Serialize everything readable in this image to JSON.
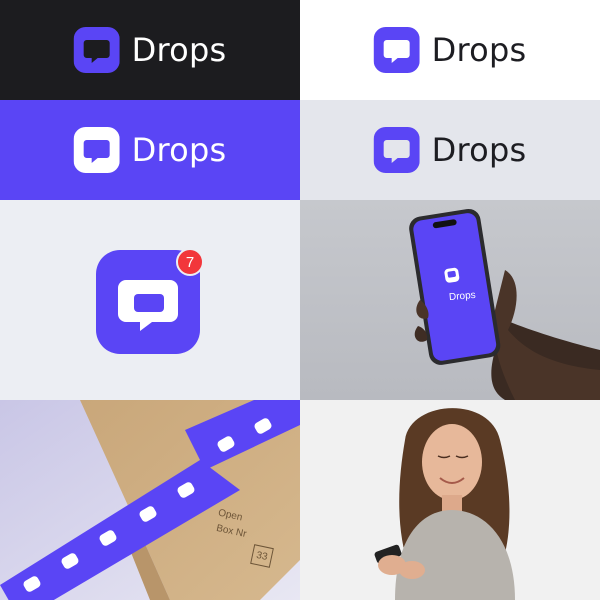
{
  "brand": {
    "name": "Drops",
    "colors": {
      "primary": "#5a45f5",
      "dark": "#1c1c1f",
      "white": "#ffffff",
      "light_gray": "#e4e6ec",
      "badge_red": "#f2363b"
    }
  },
  "tiles": {
    "dark_logo": {
      "wordmark": "Drops"
    },
    "white_logo": {
      "wordmark": "Drops"
    },
    "purple_logo": {
      "wordmark": "Drops"
    },
    "gray_logo": {
      "wordmark": "Drops"
    },
    "app_icon": {
      "badge_count": "7"
    },
    "phone_mockup": {
      "screen_label": "Drops"
    },
    "package_photo": {
      "box_text_1": "Open",
      "box_text_2": "Box Nr",
      "box_number": "33"
    },
    "person_photo": {}
  },
  "icons": {
    "logo_mark": "chat-bubble-icon"
  }
}
